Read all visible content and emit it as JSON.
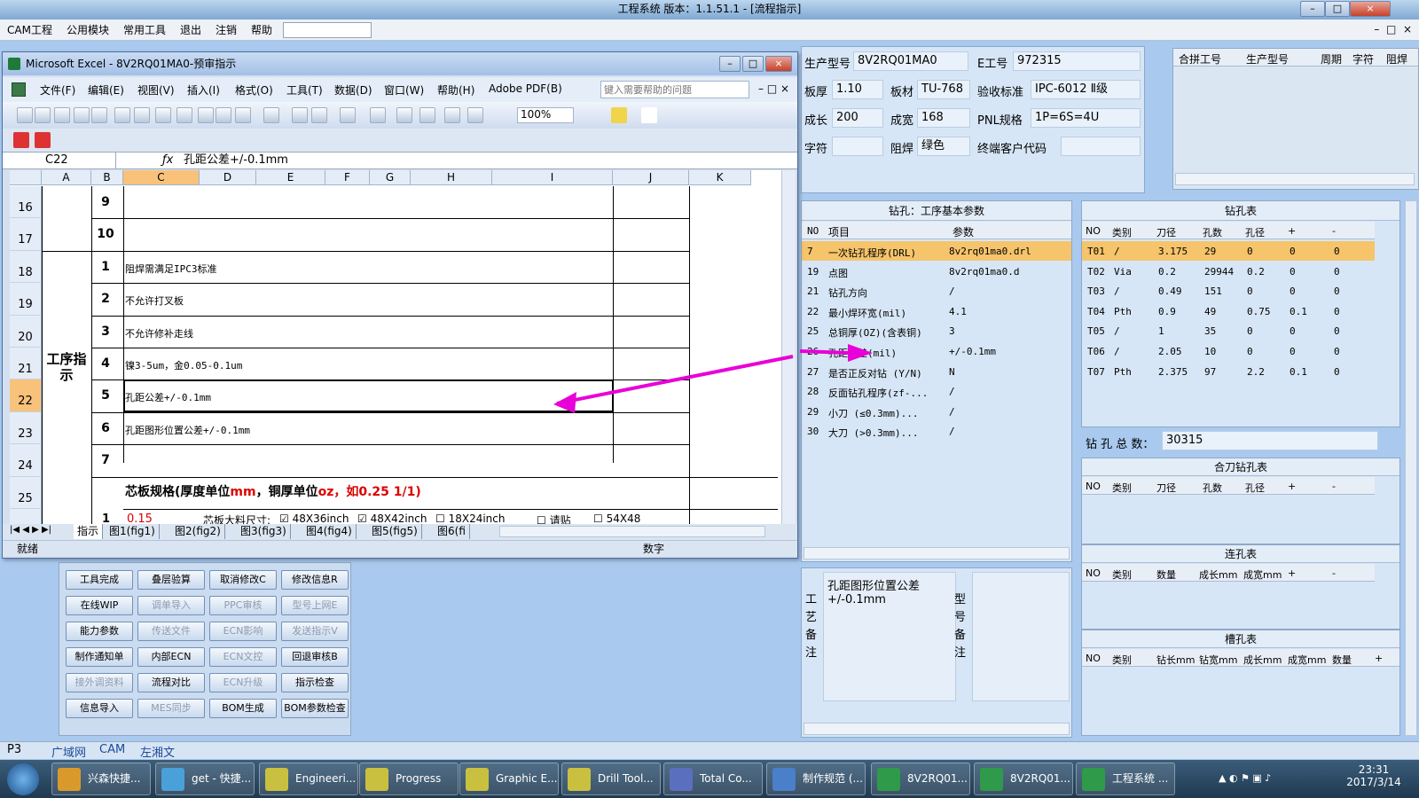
{
  "host": {
    "title": "工程系统  版本：1.1.51.1 - [流程指示]",
    "menu": [
      "CAM工程",
      "公用模块",
      "常用工具",
      "退出",
      "注销",
      "帮助"
    ],
    "window_controls": [
      "–",
      "□",
      "×"
    ]
  },
  "info": {
    "prod_model_label": "生产型号",
    "prod_model": "8V2RQ01MA0",
    "e_no_label": "E工号",
    "e_no": "972315",
    "thickness_label": "板厚",
    "thickness": "1.10",
    "material_label": "板材",
    "material": "TU-768",
    "standard_label": "验收标准",
    "standard": "IPC-6012 Ⅱ级",
    "grow_label": "成长",
    "grow": "200",
    "width_label": "成宽",
    "width": "168",
    "pnl_label": "PNL规格",
    "pnl": "1P=6S=4U",
    "char_label": "字符",
    "char": "",
    "mask_label": "阻焊",
    "mask": "绿色",
    "customer_label": "终端客户代码",
    "customer": ""
  },
  "merge_table": {
    "headers": [
      "合拼工号",
      "生产型号",
      "周期",
      "字符",
      "阻焊"
    ]
  },
  "drill_params": {
    "title": "钻孔：工序基本参数",
    "headers": [
      "NO",
      "项目",
      "参数"
    ],
    "rows": [
      [
        "7",
        "一次钻孔程序(DRL)",
        "8v2rq01ma0.drl"
      ],
      [
        "19",
        "点图",
        "8v2rq01ma0.d"
      ],
      [
        "21",
        "钻孔方向",
        "/"
      ],
      [
        "22",
        "最小焊环宽(mil)",
        "4.1"
      ],
      [
        "25",
        "总铜厚(OZ)(含表铜)",
        "3"
      ],
      [
        "26",
        "孔距公差(mil)",
        "+/-0.1mm"
      ],
      [
        "27",
        "是否正反对钻 (Y/N)",
        "N"
      ],
      [
        "28",
        "反面钻孔程序(zf-...",
        "/"
      ],
      [
        "29",
        "小刀 (≤0.3mm)...",
        "/"
      ],
      [
        "30",
        "大刀 (>0.3mm)...",
        "/"
      ]
    ]
  },
  "drill_table": {
    "title": "钻孔表",
    "headers": [
      "NO",
      "类别",
      "刀径",
      "孔数",
      "孔径",
      "+",
      "-"
    ],
    "rows": [
      [
        "T01",
        "/",
        "3.175",
        "29",
        "0",
        "0",
        "0"
      ],
      [
        "T02",
        "Via",
        "0.2",
        "29944",
        "0.2",
        "0",
        "0"
      ],
      [
        "T03",
        "/",
        "0.49",
        "151",
        "0",
        "0",
        "0"
      ],
      [
        "T04",
        "Pth",
        "0.9",
        "49",
        "0.75",
        "0.1",
        "0"
      ],
      [
        "T05",
        "/",
        "1",
        "35",
        "0",
        "0",
        "0"
      ],
      [
        "T06",
        "/",
        "2.05",
        "10",
        "0",
        "0",
        "0"
      ],
      [
        "T07",
        "Pth",
        "2.375",
        "97",
        "2.2",
        "0.1",
        "0"
      ]
    ],
    "total_label": "钻 孔 总 数：",
    "total": "30315"
  },
  "combo_drill": {
    "title": "合刀钻孔表",
    "headers": [
      "NO",
      "类别",
      "刀径",
      "孔数",
      "孔径",
      "+",
      "-"
    ]
  },
  "chain_hole": {
    "title": "连孔表",
    "headers": [
      "NO",
      "类别",
      "数量",
      "成长mm",
      "成宽mm",
      "+",
      "-"
    ]
  },
  "slot_hole": {
    "title": "槽孔表",
    "headers": [
      "NO",
      "类别",
      "钻长mm",
      "钻宽mm",
      "成长mm",
      "成宽mm",
      "数量",
      "+"
    ]
  },
  "remarks": {
    "process_label": "工艺备注",
    "process_text": "孔距图形位置公差+/-0.1mm",
    "model_label": "型号备注"
  },
  "buttons": [
    [
      {
        "l": "工具完成",
        "d": false
      },
      {
        "l": "叠层验算",
        "d": false
      },
      {
        "l": "取消修改C",
        "d": false
      },
      {
        "l": "修改信息R",
        "d": false
      }
    ],
    [
      {
        "l": "在线WIP",
        "d": false
      },
      {
        "l": "调单导入",
        "d": true
      },
      {
        "l": "PPC审核",
        "d": true
      },
      {
        "l": "型号上网E",
        "d": true
      }
    ],
    [
      {
        "l": "能力参数",
        "d": false
      },
      {
        "l": "传送文件",
        "d": true
      },
      {
        "l": "ECN影响",
        "d": true
      },
      {
        "l": "发送指示V",
        "d": true
      }
    ],
    [
      {
        "l": "制作通知单",
        "d": false
      },
      {
        "l": "内部ECN",
        "d": false
      },
      {
        "l": "ECN文控",
        "d": true
      },
      {
        "l": "回退审核B",
        "d": false
      }
    ],
    [
      {
        "l": "接外调资料",
        "d": true
      },
      {
        "l": "流程对比",
        "d": false
      },
      {
        "l": "ECN升级",
        "d": true
      },
      {
        "l": "指示检查",
        "d": false
      }
    ],
    [
      {
        "l": "信息导入",
        "d": false
      },
      {
        "l": "MES同步",
        "d": true
      },
      {
        "l": "BOM生成",
        "d": false
      },
      {
        "l": "BOM参数检查",
        "d": false
      }
    ]
  ],
  "excel": {
    "title": "Microsoft Excel - 8V2RQ01MA0-预审指示",
    "menu": [
      "文件(F)",
      "编辑(E)",
      "视图(V)",
      "插入(I)",
      "格式(O)",
      "工具(T)",
      "数据(D)",
      "窗口(W)",
      "帮助(H)",
      "Adobe PDF(B)"
    ],
    "help_placeholder": "键入需要帮助的问题",
    "zoom": "100%",
    "cell_ref": "C22",
    "formula": "孔距公差+/-0.1mm",
    "columns": [
      "A",
      "B",
      "C",
      "D",
      "E",
      "F",
      "G",
      "H",
      "I",
      "J",
      "K"
    ],
    "rows": [
      {
        "r": "16",
        "no": "9",
        "text": ""
      },
      {
        "r": "17",
        "no": "10",
        "text": ""
      },
      {
        "r": "18",
        "no": "1",
        "text": "阻焊需满足IPC3标准"
      },
      {
        "r": "19",
        "no": "2",
        "text": "不允许打叉板"
      },
      {
        "r": "20",
        "no": "3",
        "text": "不允许修补走线"
      },
      {
        "r": "21",
        "no": "4",
        "text": "镍3-5um，金0.05-0.1um"
      },
      {
        "r": "22",
        "no": "5",
        "text": "孔距公差+/-0.1mm"
      },
      {
        "r": "23",
        "no": "6",
        "text": "孔距图形位置公差+/-0.1mm"
      },
      {
        "r": "24",
        "no": "7",
        "text": ""
      }
    ],
    "section_label": "工序指示",
    "row25_text_a": "芯板规格(厚度单位",
    "row25_text_b": "mm",
    "row25_text_c": "，铜厚单位",
    "row25_text_d": "oz",
    "row25_text_e": "，如0.25 1/1)",
    "row25_num": "25",
    "row26_no": "1",
    "row26_val": "0.15",
    "row26_label": "芯板大料尺寸:",
    "row26_opts": [
      "☑ 48X36inch",
      "☑ 48X42inch",
      "☐ 18X24inch",
      "☐ 请贴",
      "☐ 54X48"
    ],
    "tabs": [
      "指示",
      "图1(fig1)",
      "图2(fig2)",
      "图3(fig3)",
      "图4(fig4)",
      "图5(fig5)",
      "图6(fi"
    ],
    "status": "就绪",
    "status_num": "数字"
  },
  "host_status": [
    "P3",
    "广域网",
    "CAM",
    "左湘文"
  ],
  "taskbar": {
    "items": [
      "兴森快捷...",
      "get - 快捷...",
      "Engineeri...",
      "Progress",
      "Graphic E...",
      "Drill Tool...",
      "Total Co...",
      "制作规范 (...",
      "8V2RQ01...",
      "8V2RQ01...",
      "工程系统 ..."
    ],
    "time": "23:31",
    "date": "2017/3/14"
  },
  "colors": {
    "arrow": "#e800d8",
    "accent": "#f8c27a"
  }
}
